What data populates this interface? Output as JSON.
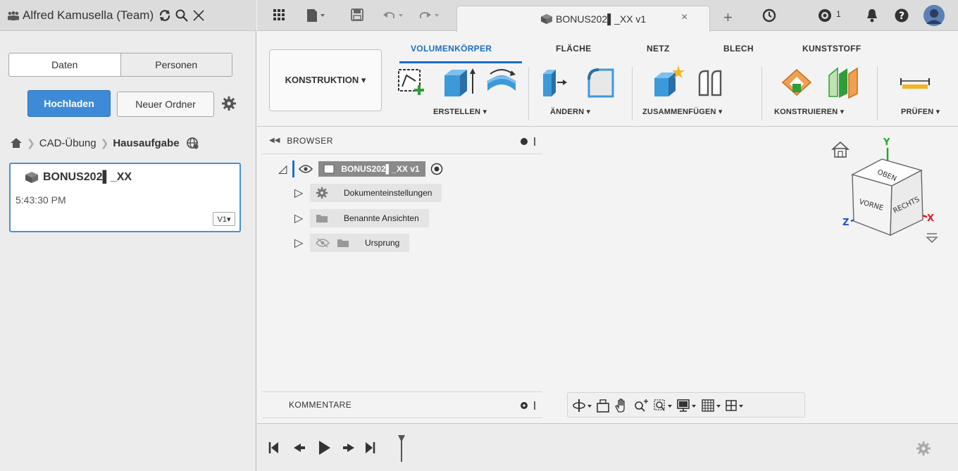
{
  "left_panel": {
    "team_name": "Alfred Kamusella (Team)",
    "tabs": [
      "Daten",
      "Personen"
    ],
    "upload_label": "Hochladen",
    "new_folder_label": "Neuer Ordner",
    "breadcrumb": [
      "CAD-Übung",
      "Hausaufgabe"
    ],
    "file_card": {
      "name": "BONUS202▌_XX",
      "time": "5:43:30 PM",
      "version": "V1▾"
    }
  },
  "document_tab": {
    "title": "BONUS202▌_XX v1",
    "close": "×"
  },
  "jobs_count": "1",
  "toolbar": {
    "workspace": "KONSTRUKTION ▾",
    "tabs": [
      "VOLUMENKÖRPER",
      "FLÄCHE",
      "NETZ",
      "BLECH",
      "KUNSTSTOFF"
    ],
    "active_tab": "VOLUMENKÖRPER",
    "groups": [
      "ERSTELLEN ▾",
      "ÄNDERN ▾",
      "ZUSAMMENFÜGEN ▾",
      "KONSTRUIEREN ▾",
      "PRÜFEN ▾"
    ]
  },
  "browser": {
    "title": "BROWSER",
    "collapse": "◀◀",
    "root": "BONUS202▌_XX v1",
    "items": [
      "Dokumenteinstellungen",
      "Benannte Ansichten",
      "Ursprung"
    ]
  },
  "viewcube": {
    "faces": [
      "OBEN",
      "VORNE",
      "RECHTS"
    ],
    "axes": [
      "Y",
      "Z",
      "X"
    ]
  },
  "comments": {
    "title": "KOMMENTARE"
  },
  "colors": {
    "accent": "#1b6fc8",
    "upload": "#3d8bd8",
    "axis_x": "#e02020",
    "axis_y": "#22aa22",
    "axis_z": "#2050d0"
  }
}
